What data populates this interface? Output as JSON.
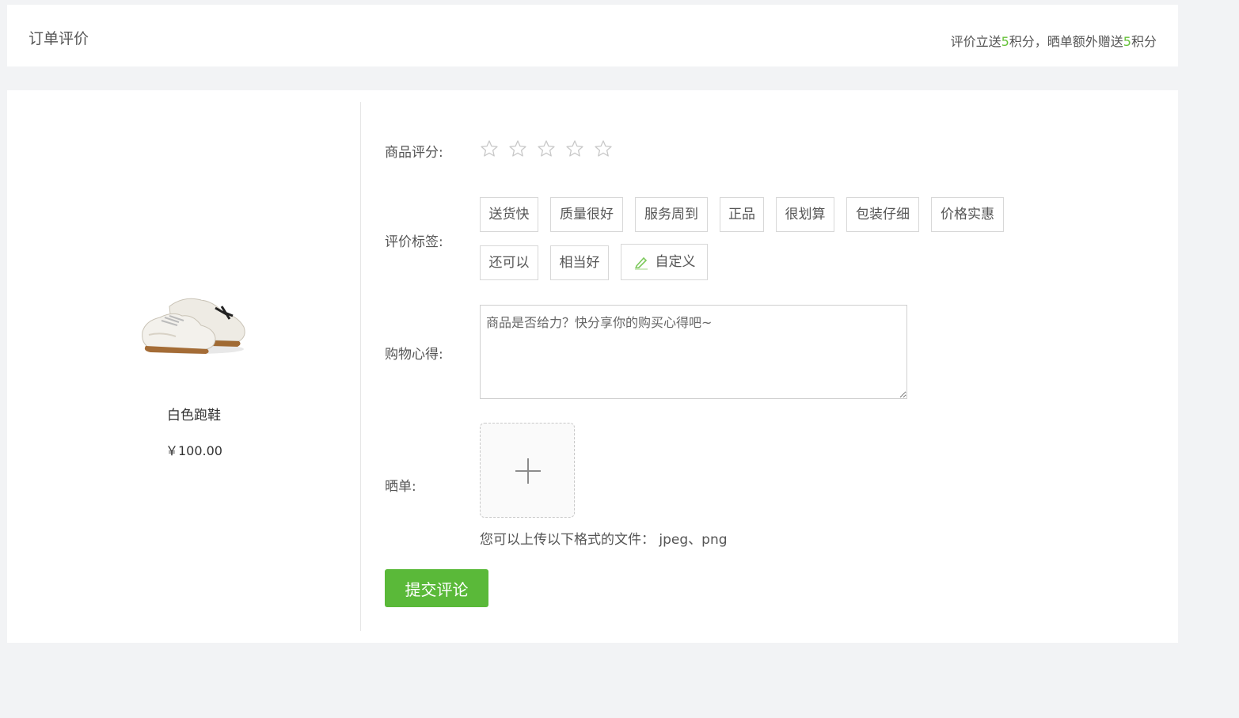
{
  "header": {
    "title": "订单评价",
    "tip_part1": "评价立送",
    "tip_num1": "5",
    "tip_part2": "积分，晒单额外赠送",
    "tip_num2": "5",
    "tip_part3": "积分"
  },
  "product": {
    "name": "白色跑鞋",
    "price": "￥100.00"
  },
  "form": {
    "rating_label": "商品评分:",
    "rating_value": 0,
    "rating_max": 5,
    "tags_label": "评价标签:",
    "tags": [
      "送货快",
      "质量很好",
      "服务周到",
      "正品",
      "很划算",
      "包装仔细",
      "价格实惠",
      "还可以",
      "相当好"
    ],
    "custom_tag": "自定义",
    "experience_label": "购物心得:",
    "experience_placeholder": "商品是否给力？快分享你的购买心得吧~",
    "upload_label": "晒单:",
    "upload_hint": "您可以上传以下格式的文件： jpeg、png",
    "submit_label": "提交评论"
  },
  "colors": {
    "accent": "#5ab939",
    "highlight": "#67c23a",
    "background": "#f2f3f5"
  }
}
